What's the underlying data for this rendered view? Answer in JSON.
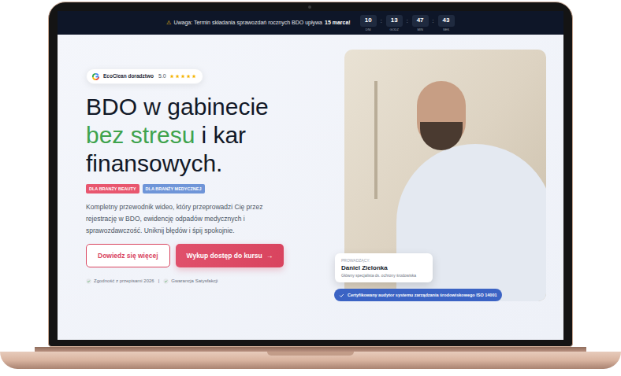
{
  "announcement": {
    "icon": "⚠",
    "text": "Uwaga: Termin składania sprawozdań rocznych BDO upływa",
    "highlight": "15 marca!"
  },
  "countdown": {
    "separator": ":",
    "items": [
      {
        "value": "10",
        "unit": "DNI"
      },
      {
        "value": "13",
        "unit": "GODZ"
      },
      {
        "value": "47",
        "unit": "MIN"
      },
      {
        "value": "43",
        "unit": "SEK"
      }
    ]
  },
  "rating": {
    "brand": "EcoClean doradztwo",
    "score": "5.0",
    "stars": 5
  },
  "hero": {
    "heading": {
      "line1": "BDO w gabinecie",
      "highlight": "bez stresu",
      "rest": "i kar finansowych."
    },
    "tags": [
      {
        "label": "DLA BRANŻY BEAUTY",
        "color": "#e8566e"
      },
      {
        "label": "DLA BRANŻY MEDYCZNEJ",
        "color": "#6f95d8"
      }
    ],
    "description": "Kompletny przewodnik wideo, który przeprowadzi Cię przez rejestrację w BDO, ewidencję odpadów medycznych i sprawozdawczość. Uniknij błędów i śpij spokojnie.",
    "buttons": {
      "secondary": "Dowiedz się więcej",
      "primary": "Wykup dostęp do kursu",
      "arrow": "→"
    },
    "guarantees": {
      "items": [
        "Zgodność z przepisami 2026",
        "Gwarancja Satysfakcji"
      ],
      "separator": "|"
    }
  },
  "presenter": {
    "label": "PROWADZĄCY:",
    "name": "Daniel Zielonka",
    "role": "Główny specjalista ds. ochrony środowiska"
  },
  "certificate": "Certyfikowany audytor systemu zarządzania środowiskowego ISO 14001"
}
